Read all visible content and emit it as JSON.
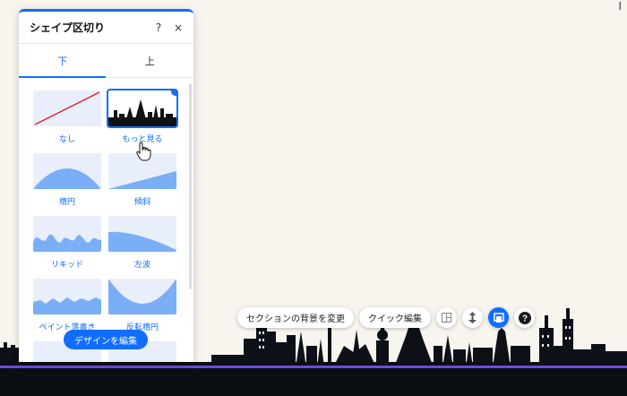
{
  "panel": {
    "title": "シェイプ区切り",
    "help_label": "?",
    "close_label": "×",
    "tabs": [
      {
        "label": "下",
        "active": true
      },
      {
        "label": "上",
        "active": false
      }
    ],
    "items": [
      {
        "label": "なし"
      },
      {
        "label": "もっと見る",
        "selected": true
      },
      {
        "label": "楕円"
      },
      {
        "label": "傾斜"
      },
      {
        "label": "リキッド"
      },
      {
        "label": "左波"
      },
      {
        "label": "ペイント落書き"
      },
      {
        "label": "反転楕円"
      }
    ],
    "edit_button_label": "デザインを編集"
  },
  "toolbar": {
    "change_bg_label": "セクションの背景を変更",
    "quick_edit_label": "クイック編集"
  },
  "colors": {
    "accent": "#116dff",
    "thumb_bg": "#e9eefb",
    "shape_fill": "#7aaef7",
    "page_bg": "#f8f5ef",
    "footer": "#0b0f14",
    "footer_line": "#6a4ce0"
  },
  "icons": {
    "toolbar": [
      "layout-icon",
      "anchor-icon",
      "edit-section-icon",
      "help-icon"
    ]
  }
}
